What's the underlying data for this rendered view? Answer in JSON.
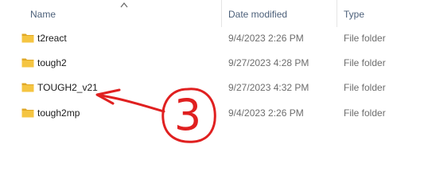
{
  "columns": {
    "name": "Name",
    "date_modified": "Date modified",
    "type": "Type"
  },
  "files": [
    {
      "name": "t2react",
      "date_modified": "9/4/2023 2:26 PM",
      "type": "File folder",
      "icon": "folder-icon"
    },
    {
      "name": "tough2",
      "date_modified": "9/27/2023 4:28 PM",
      "type": "File folder",
      "icon": "folder-icon"
    },
    {
      "name": "TOUGH2_v21",
      "date_modified": "9/27/2023 4:32 PM",
      "type": "File folder",
      "icon": "folder-icon"
    },
    {
      "name": "tough2mp",
      "date_modified": "9/4/2023 2:26 PM",
      "type": "File folder",
      "icon": "folder-icon"
    }
  ],
  "annotation": {
    "number": "3",
    "color": "#e02020"
  },
  "colors": {
    "folder": "#f5c542",
    "folder_dark": "#e0a826",
    "header_text": "#4c607a",
    "meta_text": "#6d6d6d"
  }
}
